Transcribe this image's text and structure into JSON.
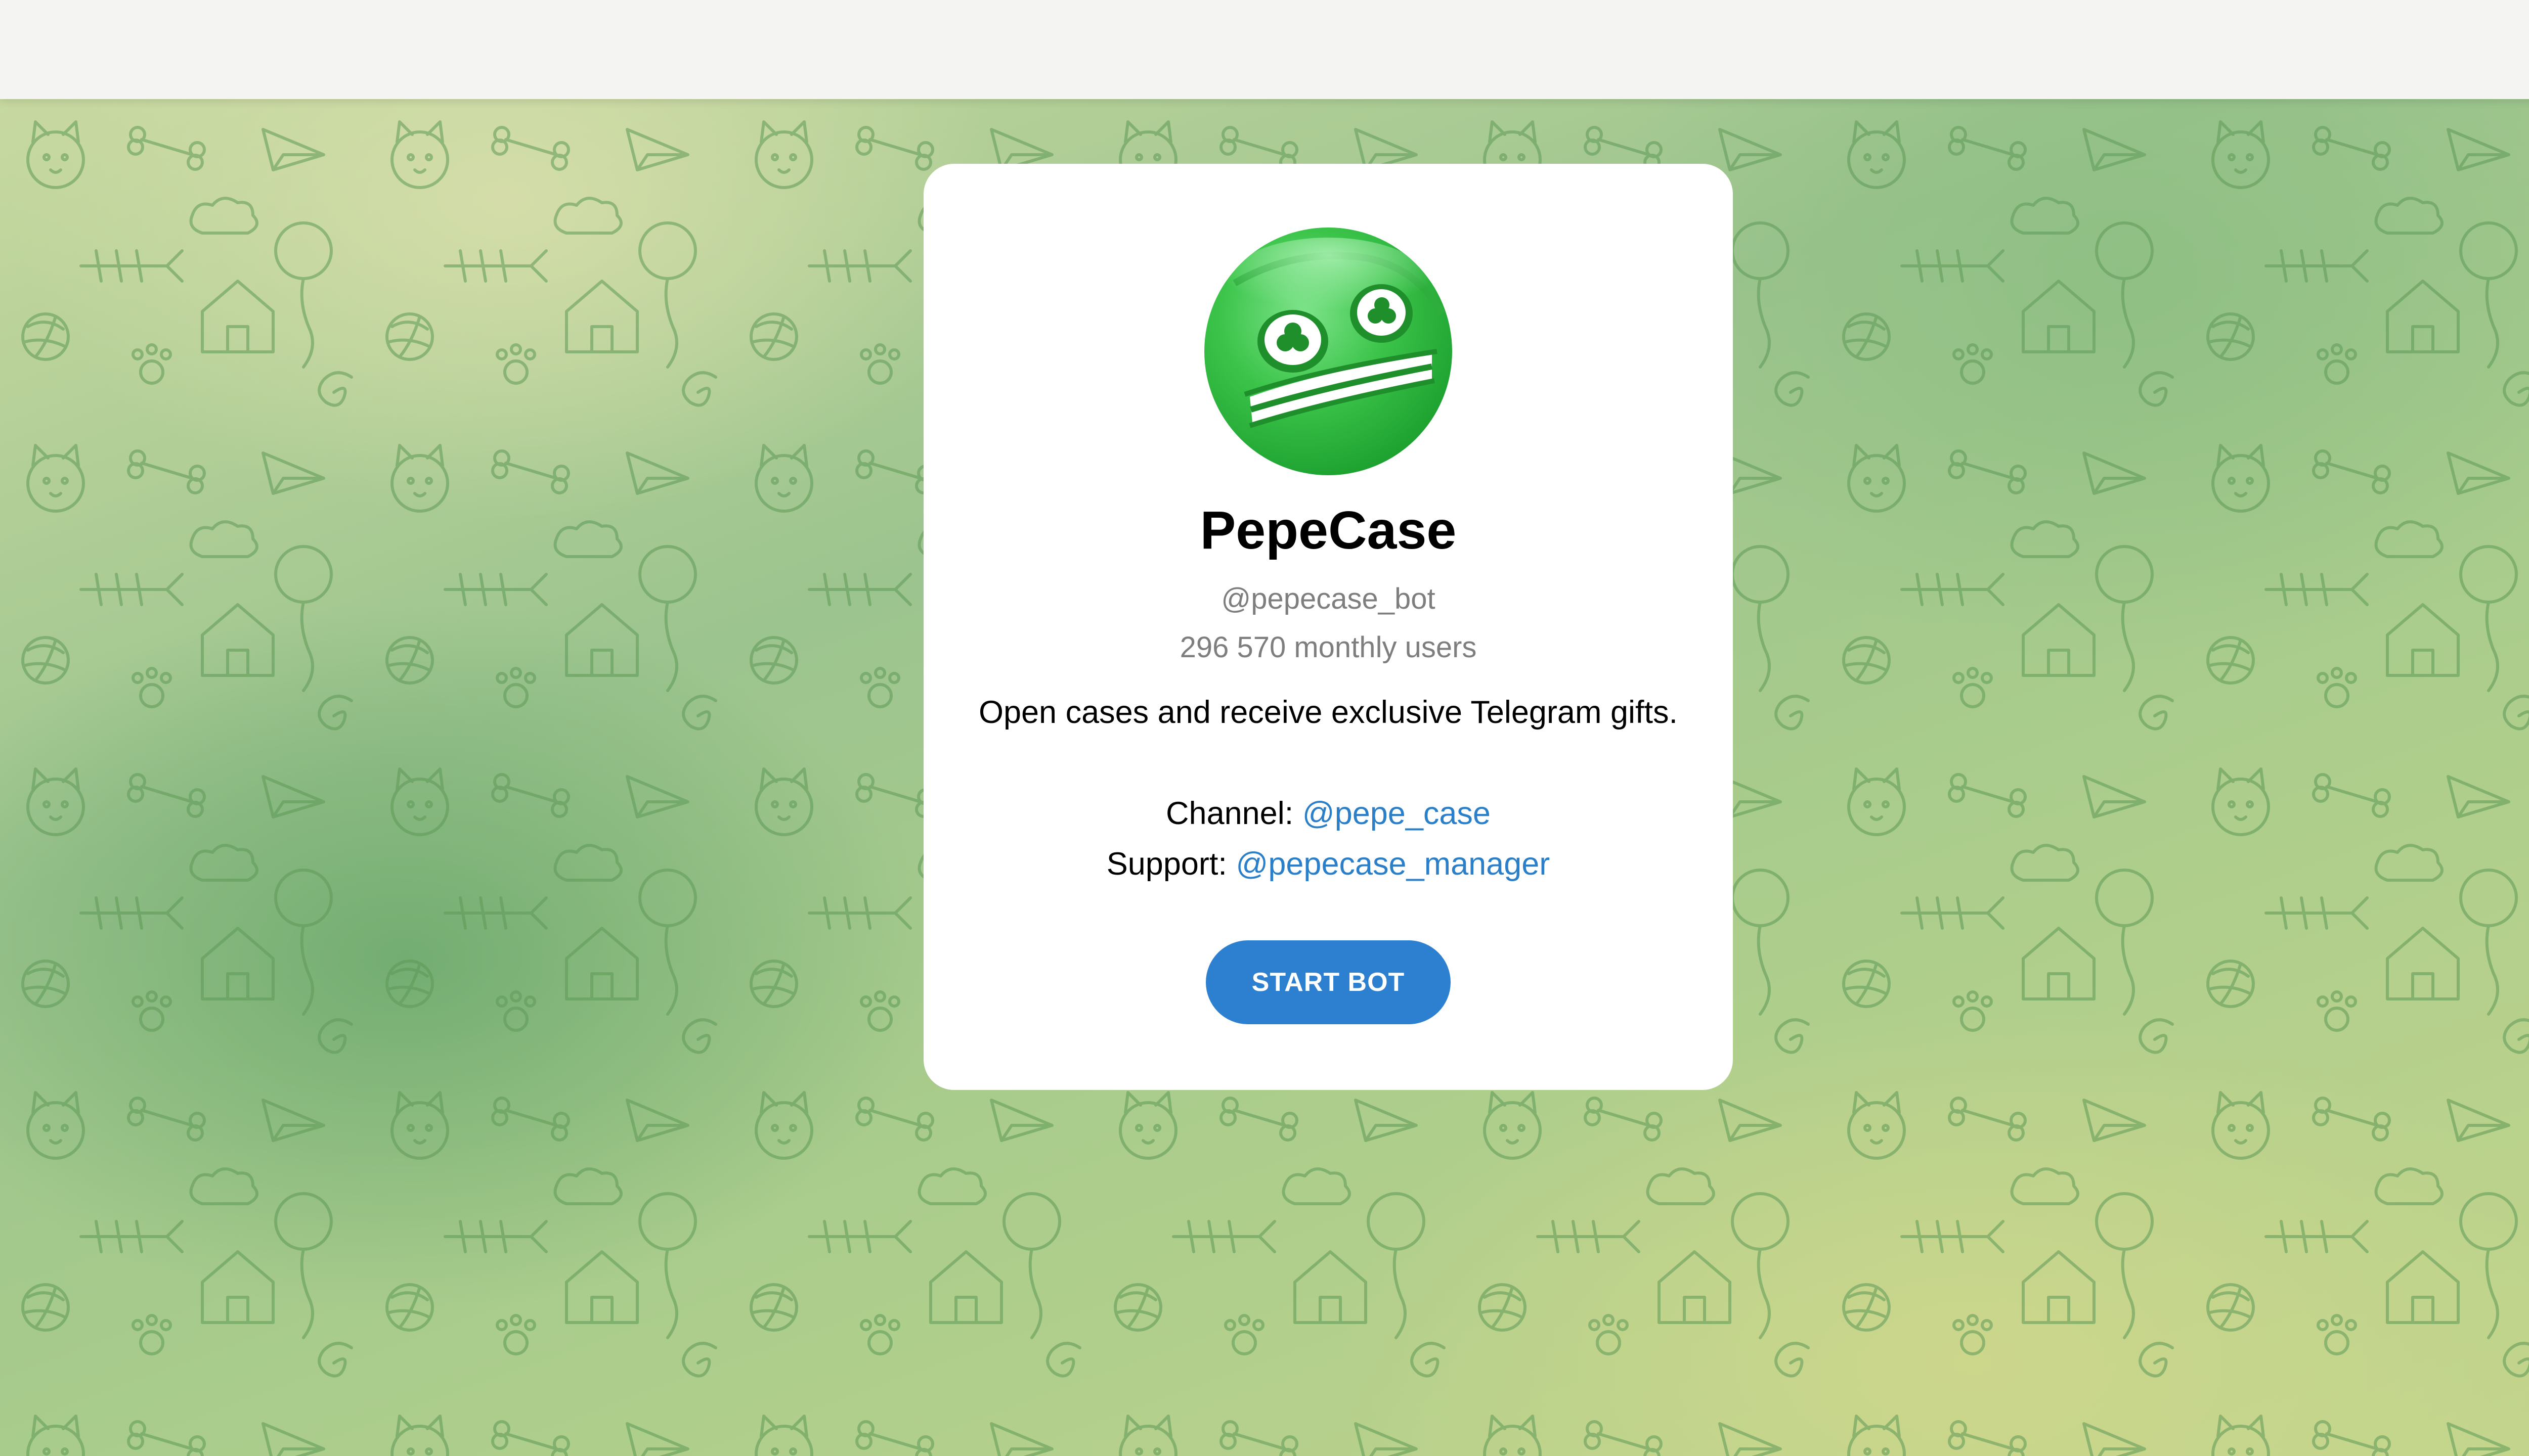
{
  "bot": {
    "name": "PepeCase",
    "username": "@pepecase_bot",
    "monthly_users": "296 570 monthly users",
    "description": "Open cases and receive exclusive Telegram gifts.",
    "channel_label": "Channel:",
    "channel_handle": "@pepe_case",
    "support_label": "Support:",
    "support_handle": "@pepecase_manager"
  },
  "actions": {
    "start_label": "START BOT"
  },
  "colors": {
    "accent": "#2d7fd0",
    "link": "#2a7fc8",
    "muted_text": "#7e7e7e",
    "avatar_green": "#3cc44a"
  },
  "icons": {
    "avatar": "pepe-frog-avatar-icon",
    "background": "doodle-pattern"
  }
}
